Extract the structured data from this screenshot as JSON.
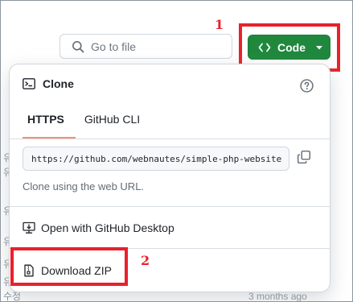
{
  "background": {
    "left_fragments": [
      "유",
      "유",
      "유",
      "유",
      "유",
      "유",
      "수정"
    ],
    "timestamp": "3 months ago"
  },
  "toolbar": {
    "search_placeholder": "Go to file",
    "code_label": "Code"
  },
  "annotations": {
    "marker_1": "1",
    "marker_2": "2",
    "color": "#e8212b"
  },
  "clone_panel": {
    "title": "Clone",
    "tabs": [
      {
        "label": "HTTPS",
        "active": true
      },
      {
        "label": "GitHub CLI",
        "active": false
      }
    ],
    "url": "https://github.com/webnautes/simple-php-website",
    "helptext": "Clone using the web URL.",
    "open_desktop": "Open with GitHub Desktop",
    "download_zip": "Download ZIP"
  },
  "colors": {
    "code_button": "#1f883d",
    "tab_underline": "#fd8c73"
  }
}
